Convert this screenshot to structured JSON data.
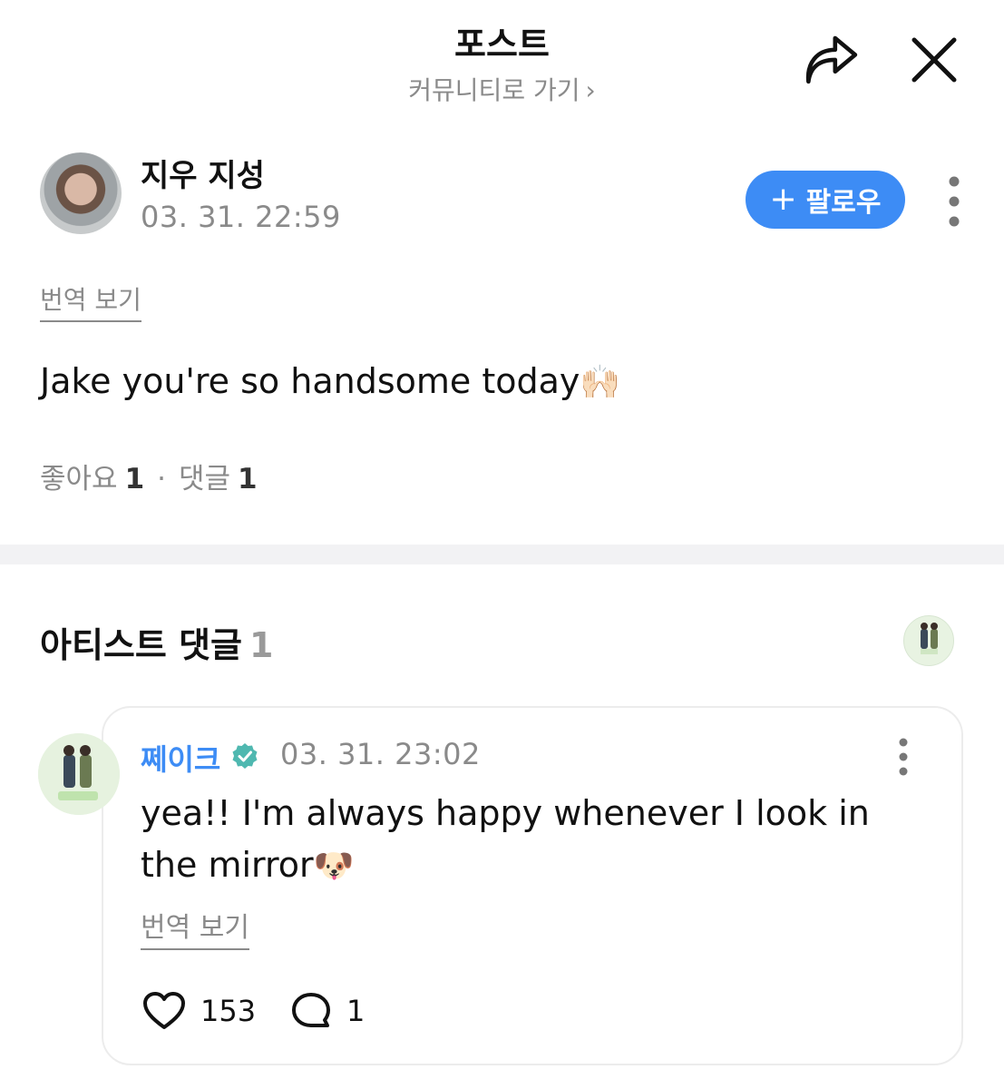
{
  "header": {
    "title": "포스트",
    "subtitle": "커뮤니티로 가기",
    "subtitle_chevron": "›"
  },
  "post": {
    "author": "지우 지성",
    "time": "03. 31. 22:59",
    "follow_label": "팔로우",
    "follow_plus": "+",
    "translate_label": "번역 보기",
    "body_text": "Jake you're so handsome today",
    "body_emoji": "🙌🏻",
    "likes_label": "좋아요",
    "likes_count": "1",
    "comments_label": "댓글",
    "comments_count": "1",
    "separator": "·"
  },
  "artist_comments": {
    "title": "아티스트 댓글",
    "count": "1",
    "comment": {
      "author": "쩨이크",
      "time": "03. 31. 23:02",
      "body_text": "yea!! I'm always happy whenever I look in the mirror",
      "body_emoji": "🐶",
      "translate_label": "번역 보기",
      "likes": "153",
      "replies": "1"
    }
  },
  "colors": {
    "accent": "#3d8cf5",
    "verified": "#4fb8b0",
    "muted": "#8a8a8a",
    "divider": "#f2f2f4"
  },
  "icons": {
    "share": "share-arrow-icon",
    "close": "close-icon",
    "more": "more-vertical-icon",
    "verified": "verified-badge-icon",
    "like": "heart-icon",
    "reply": "comment-bubble-icon"
  }
}
